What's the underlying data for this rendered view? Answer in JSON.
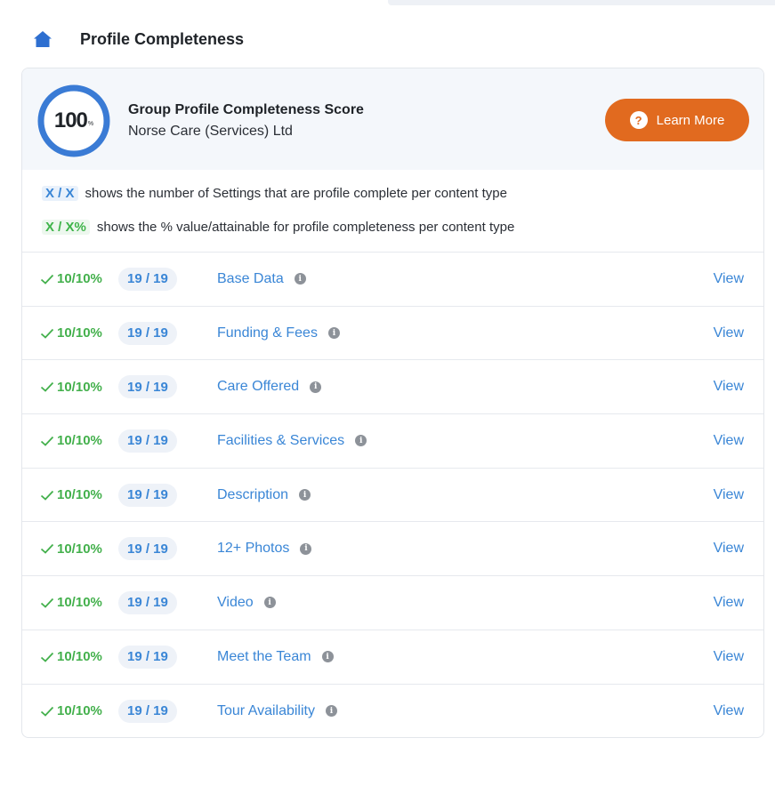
{
  "header": {
    "title": "Profile Completeness",
    "icon": "home-icon"
  },
  "score": {
    "value": "100",
    "suffix": "%",
    "title": "Group Profile Completeness Score",
    "org": "Norse Care (Services) Ltd",
    "learn_more": "Learn More",
    "ring_color": "#3a7bd5",
    "button_color": "#e16a1f"
  },
  "legend": {
    "blue_token": "X / X",
    "blue_text": "shows the number of Settings that are profile complete per content type",
    "green_token": "X / X%",
    "green_text": "shows the % value/attainable for profile completeness per content type"
  },
  "rows": [
    {
      "pct": "10/10%",
      "count": "19 / 19",
      "label": "Base Data",
      "action": "View"
    },
    {
      "pct": "10/10%",
      "count": "19 / 19",
      "label": "Funding & Fees",
      "action": "View"
    },
    {
      "pct": "10/10%",
      "count": "19 / 19",
      "label": "Care Offered",
      "action": "View"
    },
    {
      "pct": "10/10%",
      "count": "19 / 19",
      "label": "Facilities & Services",
      "action": "View"
    },
    {
      "pct": "10/10%",
      "count": "19 / 19",
      "label": "Description",
      "action": "View"
    },
    {
      "pct": "10/10%",
      "count": "19 / 19",
      "label": "12+ Photos",
      "action": "View"
    },
    {
      "pct": "10/10%",
      "count": "19 / 19",
      "label": "Video",
      "action": "View"
    },
    {
      "pct": "10/10%",
      "count": "19 / 19",
      "label": "Meet the Team",
      "action": "View"
    },
    {
      "pct": "10/10%",
      "count": "19 / 19",
      "label": "Tour Availability",
      "action": "View"
    }
  ]
}
